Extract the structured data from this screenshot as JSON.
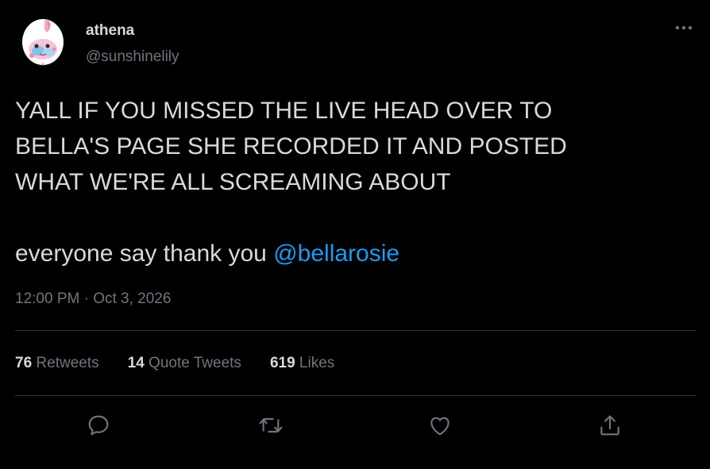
{
  "user": {
    "display_name": "athena",
    "handle": "@sunshinelily"
  },
  "tweet": {
    "text": "YALL IF YOU MISSED THE LIVE HEAD OVER TO\nBELLA'S PAGE SHE RECORDED IT AND POSTED\nWHAT WE'RE ALL SCREAMING ABOUT",
    "text_line2_prefix": "everyone say thank you ",
    "mention": "@bellarosie",
    "timestamp": "12:00 PM · Oct 3, 2026"
  },
  "stats": {
    "retweets_count": "76",
    "retweets_label": "Retweets",
    "quote_count": "14",
    "quote_label": "Quote Tweets",
    "likes_count": "619",
    "likes_label": "Likes"
  },
  "actions": {
    "icons": [
      "reply-icon",
      "retweet-icon",
      "like-icon",
      "share-icon"
    ]
  },
  "colors": {
    "background": "#000000",
    "text": "#d9d9d9",
    "secondary": "#6e767d",
    "link": "#1d9bf0",
    "divider": "#2f3336"
  }
}
